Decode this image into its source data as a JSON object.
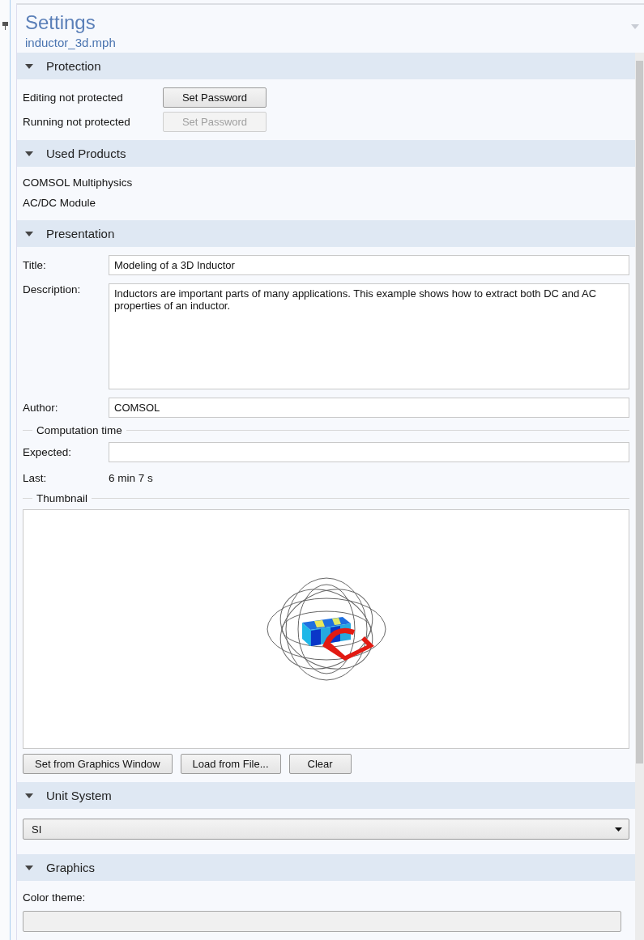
{
  "header": {
    "title": "Settings",
    "subtitle": "inductor_3d.mph"
  },
  "sections": [
    {
      "kind": "protection",
      "title": "Protection",
      "expanded": true,
      "rows": [
        {
          "label": "Editing not protected",
          "button": "Set Password",
          "disabled": false
        },
        {
          "label": "Running not protected",
          "button": "Set Password",
          "disabled": true
        }
      ]
    },
    {
      "kind": "products",
      "title": "Used Products",
      "expanded": true,
      "items": [
        "COMSOL Multiphysics",
        "AC/DC Module"
      ]
    },
    {
      "kind": "presentation",
      "title": "Presentation",
      "expanded": true,
      "title_field": {
        "label": "Title:",
        "value": "Modeling of a 3D Inductor"
      },
      "description": {
        "label": "Description:",
        "value": "Inductors are important parts of many applications. This example shows how to extract both DC and AC properties of an inductor."
      },
      "author": {
        "label": "Author:",
        "value": "COMSOL"
      },
      "computation_time": {
        "heading": "Computation time",
        "expected": {
          "label": "Expected:"
        },
        "last": {
          "label": "Last:",
          "value": "6 min 7 s"
        }
      },
      "thumbnail": {
        "heading": "Thumbnail",
        "buttons": [
          "Set from Graphics Window",
          "Load from File...",
          "Clear"
        ]
      }
    },
    {
      "kind": "select",
      "title": "Unit System",
      "expanded": true,
      "value": "SI"
    },
    {
      "kind": "graphics",
      "title": "Graphics",
      "expanded": true,
      "label": "Color theme:"
    }
  ]
}
